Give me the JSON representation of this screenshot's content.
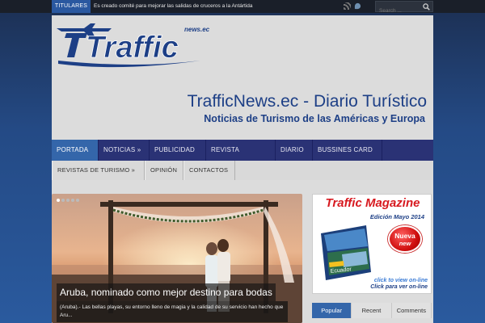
{
  "topbar": {
    "label": "TITULARES",
    "ticker": "Es creado comité para mejorar las salidas de cruceros a la Antártida",
    "search_placeholder": "Search ...",
    "icons": [
      "rss-icon",
      "twitter-icon",
      "search-icon"
    ]
  },
  "header": {
    "logo_text": "Traffic",
    "logo_domain": "news.ec",
    "site_title": "TrafficNews.ec - Diario Turístico",
    "site_subtitle": "Noticias de Turismo de las Américas y Europa"
  },
  "nav": {
    "row1": [
      "PORTADA »",
      "NOTICIAS »",
      "PUBLICIDAD »",
      "REVISTA IMPRESA",
      "DIARIO",
      "BUSSINES CARD »"
    ],
    "row2": [
      "REVISTAS DE TURISMO »",
      "OPINIÓN",
      "CONTACTOS"
    ],
    "active": "PORTADA »"
  },
  "slider": {
    "title": "Aruba, nominado como mejor destino para bodas",
    "excerpt": "(Aruba).- Las bellas playas, su entorno lleno de magia y la calidad de su servicio han hecho que Aru...",
    "dots": 5,
    "active_dot": 0
  },
  "magazine": {
    "title": "Traffic Magazine",
    "edition": "Edición Mayo 2014",
    "badge_line1": "Nueva",
    "badge_line2": "new",
    "click_en": "click to view on-line",
    "click_es": "Click para ver on-line"
  },
  "tabs": {
    "items": [
      "Popular",
      "Recent",
      "Comments"
    ],
    "active": "Popular"
  },
  "colors": {
    "accent": "#3466aa",
    "nav_bg": "#2a3275",
    "brand_blue": "#1d3f86",
    "magazine_red": "#d7191f"
  }
}
